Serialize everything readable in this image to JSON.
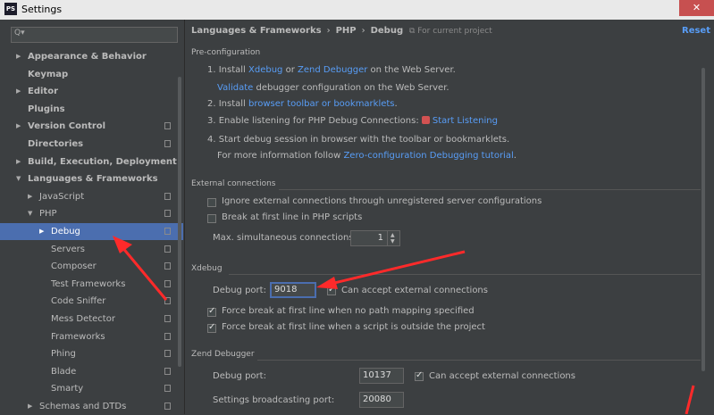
{
  "window": {
    "app_icon": "PS",
    "title": "Settings",
    "close": "✕"
  },
  "search": {
    "icon": "Q▾"
  },
  "tree": [
    {
      "label": "Appearance & Behavior",
      "arrow": "▶",
      "bold": true,
      "copy": false
    },
    {
      "label": "Keymap",
      "arrow": "",
      "bold": true,
      "copy": false
    },
    {
      "label": "Editor",
      "arrow": "▶",
      "bold": true,
      "copy": false
    },
    {
      "label": "Plugins",
      "arrow": "",
      "bold": true,
      "copy": false
    },
    {
      "label": "Version Control",
      "arrow": "▶",
      "bold": true,
      "copy": true
    },
    {
      "label": "Directories",
      "arrow": "",
      "bold": true,
      "copy": true
    },
    {
      "label": "Build, Execution, Deployment",
      "arrow": "▶",
      "bold": true,
      "copy": false
    },
    {
      "label": "Languages & Frameworks",
      "arrow": "▼",
      "bold": true,
      "copy": false
    },
    {
      "label": "JavaScript",
      "arrow": "▶",
      "bold": false,
      "copy": true
    },
    {
      "label": "PHP",
      "arrow": "▼",
      "bold": false,
      "copy": true
    },
    {
      "label": "Debug",
      "arrow": "▶",
      "bold": false,
      "copy": true,
      "selected": true
    },
    {
      "label": "Servers",
      "arrow": "",
      "bold": false,
      "copy": true
    },
    {
      "label": "Composer",
      "arrow": "",
      "bold": false,
      "copy": true
    },
    {
      "label": "Test Frameworks",
      "arrow": "",
      "bold": false,
      "copy": true
    },
    {
      "label": "Code Sniffer",
      "arrow": "",
      "bold": false,
      "copy": true
    },
    {
      "label": "Mess Detector",
      "arrow": "",
      "bold": false,
      "copy": true
    },
    {
      "label": "Frameworks",
      "arrow": "",
      "bold": false,
      "copy": true
    },
    {
      "label": "Phing",
      "arrow": "",
      "bold": false,
      "copy": true
    },
    {
      "label": "Blade",
      "arrow": "",
      "bold": false,
      "copy": true
    },
    {
      "label": "Smarty",
      "arrow": "",
      "bold": false,
      "copy": true
    },
    {
      "label": "Schemas and DTDs",
      "arrow": "▶",
      "bold": false,
      "copy": true
    }
  ],
  "breadcrumb": {
    "part1": "Languages & Frameworks",
    "sep": "›",
    "part2": "PHP",
    "part3": "Debug"
  },
  "for_project": "⧉ For current project",
  "reset": "Reset",
  "preconfig": {
    "title": "Pre-configuration",
    "step1_prefix": "1. Install ",
    "step1_link1": "Xdebug",
    "step1_or": " or ",
    "step1_link2": "Zend Debugger",
    "step1_suffix": " on the Web Server.",
    "step1b_link": "Validate",
    "step1b_suffix": " debugger configuration on the Web Server.",
    "step2_prefix": "2. Install ",
    "step2_link": "browser toolbar or bookmarklets",
    "step2_suffix": ".",
    "step3_prefix": "3. Enable listening for PHP Debug Connections: ",
    "step3_link": "Start Listening",
    "step4": "4. Start debug session in browser with the toolbar or bookmarklets.",
    "more_prefix": "For more information follow ",
    "more_link": "Zero-configuration Debugging tutorial",
    "more_suffix": "."
  },
  "external": {
    "title": "External connections",
    "ignore_label": "Ignore external connections through unregistered server configurations",
    "ignore_checked": false,
    "break_label": "Break at first line in PHP scripts",
    "break_checked": false,
    "max_label": "Max. simultaneous connections:",
    "max_value": "1",
    "spin_up": "▲",
    "spin_down": "▼"
  },
  "xdebug": {
    "title": "Xdebug",
    "port_label": "Debug port:",
    "port_value": "9018",
    "accept_label": "Can accept external connections",
    "accept_checked": true,
    "force1_label": "Force break at first line when no path mapping specified",
    "force1_checked": true,
    "force2_label": "Force break at first line when a script is outside the project",
    "force2_checked": true
  },
  "zend": {
    "title": "Zend Debugger",
    "port_label": "Debug port:",
    "port_value": "10137",
    "accept_label": "Can accept external connections",
    "accept_checked": true,
    "broadcast_label": "Settings broadcasting port:",
    "broadcast_value": "20080"
  },
  "colors": {
    "accent": "#4b6eaf",
    "link": "#589df6",
    "annotation": "#ff2a2a",
    "background": "#3c3f41"
  }
}
